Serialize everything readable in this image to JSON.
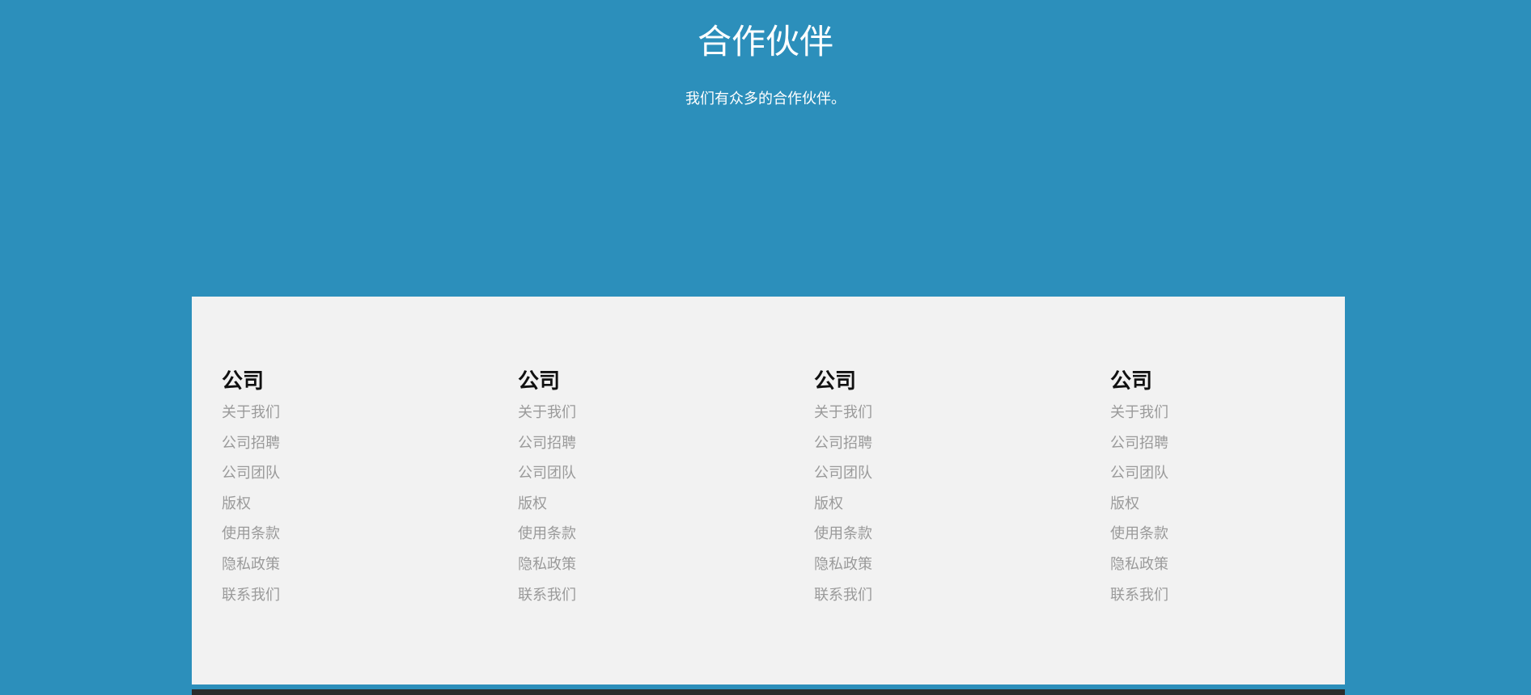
{
  "partners": {
    "title": "合作伙伴",
    "subtitle": "我们有众多的合作伙伴。"
  },
  "footer": {
    "columns": [
      {
        "title": "公司",
        "links": [
          "关于我们",
          "公司招聘",
          "公司团队",
          "版权",
          "使用条款",
          "隐私政策",
          "联系我们"
        ]
      },
      {
        "title": "公司",
        "links": [
          "关于我们",
          "公司招聘",
          "公司团队",
          "版权",
          "使用条款",
          "隐私政策",
          "联系我们"
        ]
      },
      {
        "title": "公司",
        "links": [
          "关于我们",
          "公司招聘",
          "公司团队",
          "版权",
          "使用条款",
          "隐私政策",
          "联系我们"
        ]
      },
      {
        "title": "公司",
        "links": [
          "关于我们",
          "公司招聘",
          "公司团队",
          "版权",
          "使用条款",
          "隐私政策",
          "联系我们"
        ]
      }
    ]
  },
  "colors": {
    "background": "#2c8fbb",
    "footer_panel": "#f2f2f2",
    "column_title": "#111111",
    "link": "#9a9a9a",
    "bottom_bar": "#2b2b2b"
  }
}
